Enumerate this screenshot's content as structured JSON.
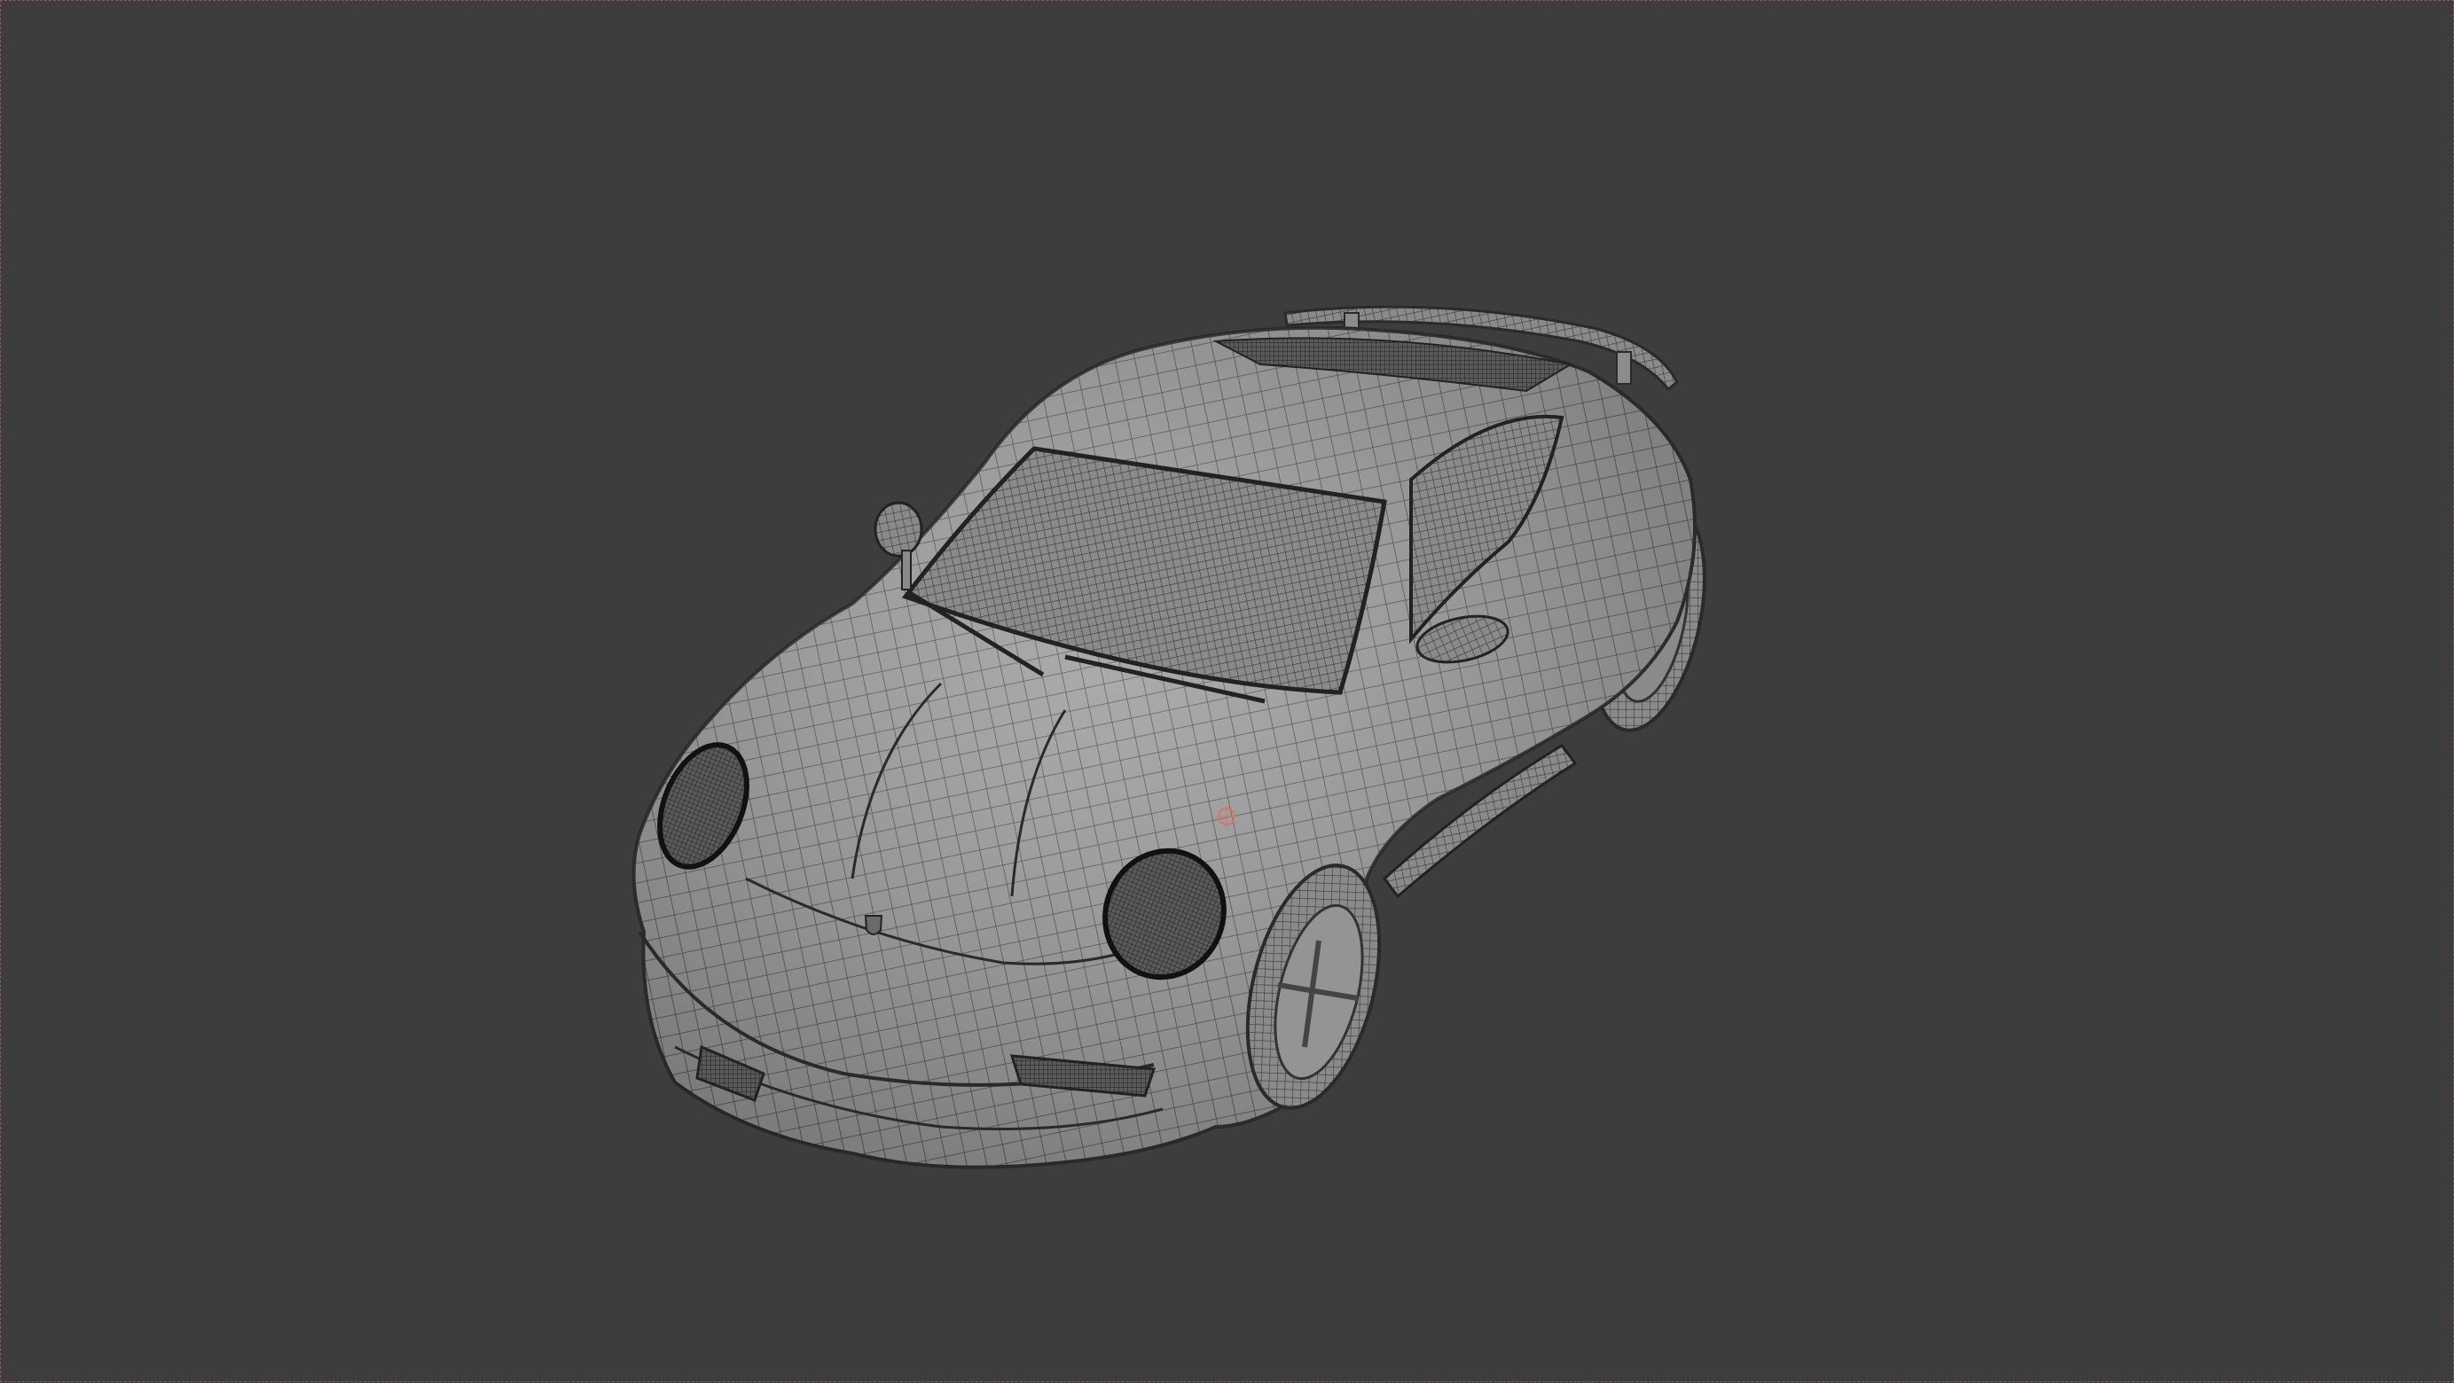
{
  "viewport": {
    "background_color": "#3d3d3d",
    "display_mode": "wireframe-on-shaded"
  },
  "model": {
    "icon": "car-wireframe-mesh",
    "body_color": "#9a9a9a",
    "wire_color": "#3a3a3a"
  },
  "origin": {
    "icon": "object-origin-icon",
    "color": "#d07a6a"
  }
}
